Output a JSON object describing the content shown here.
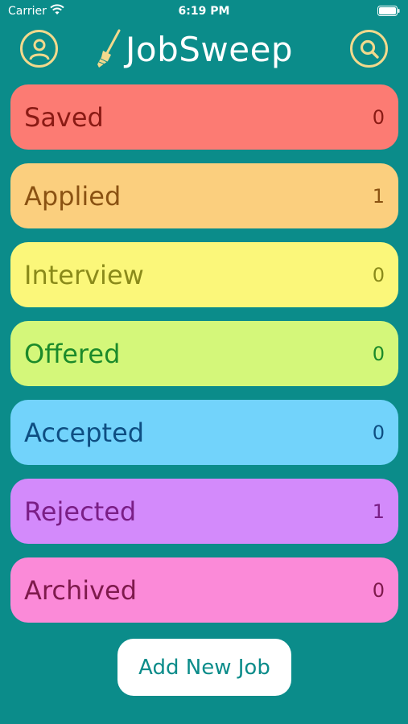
{
  "status_bar": {
    "carrier": "Carrier",
    "time": "6:19 PM"
  },
  "header": {
    "title": "JobSweep",
    "icons": {
      "profile": "person-circle-icon",
      "search": "magnifier-icon",
      "logo": "broom-icon"
    },
    "accent_color": "#f2d98c"
  },
  "statuses": [
    {
      "label": "Saved",
      "count": "0",
      "bg": "#fc7b73",
      "fg": "#8a1a14"
    },
    {
      "label": "Applied",
      "count": "1",
      "bg": "#fbcf7e",
      "fg": "#8a5212"
    },
    {
      "label": "Interview",
      "count": "0",
      "bg": "#fbf77a",
      "fg": "#8a8a1a"
    },
    {
      "label": "Offered",
      "count": "0",
      "bg": "#d4f77a",
      "fg": "#1b8a2a"
    },
    {
      "label": "Accepted",
      "count": "0",
      "bg": "#72d3fb",
      "fg": "#0e4e82"
    },
    {
      "label": "Rejected",
      "count": "1",
      "bg": "#d38afb",
      "fg": "#7a1e86"
    },
    {
      "label": "Archived",
      "count": "0",
      "bg": "#fb8ad8",
      "fg": "#7e1a4c"
    }
  ],
  "add_button": {
    "label": "Add New Job"
  },
  "colors": {
    "background": "#0b8c8a"
  }
}
